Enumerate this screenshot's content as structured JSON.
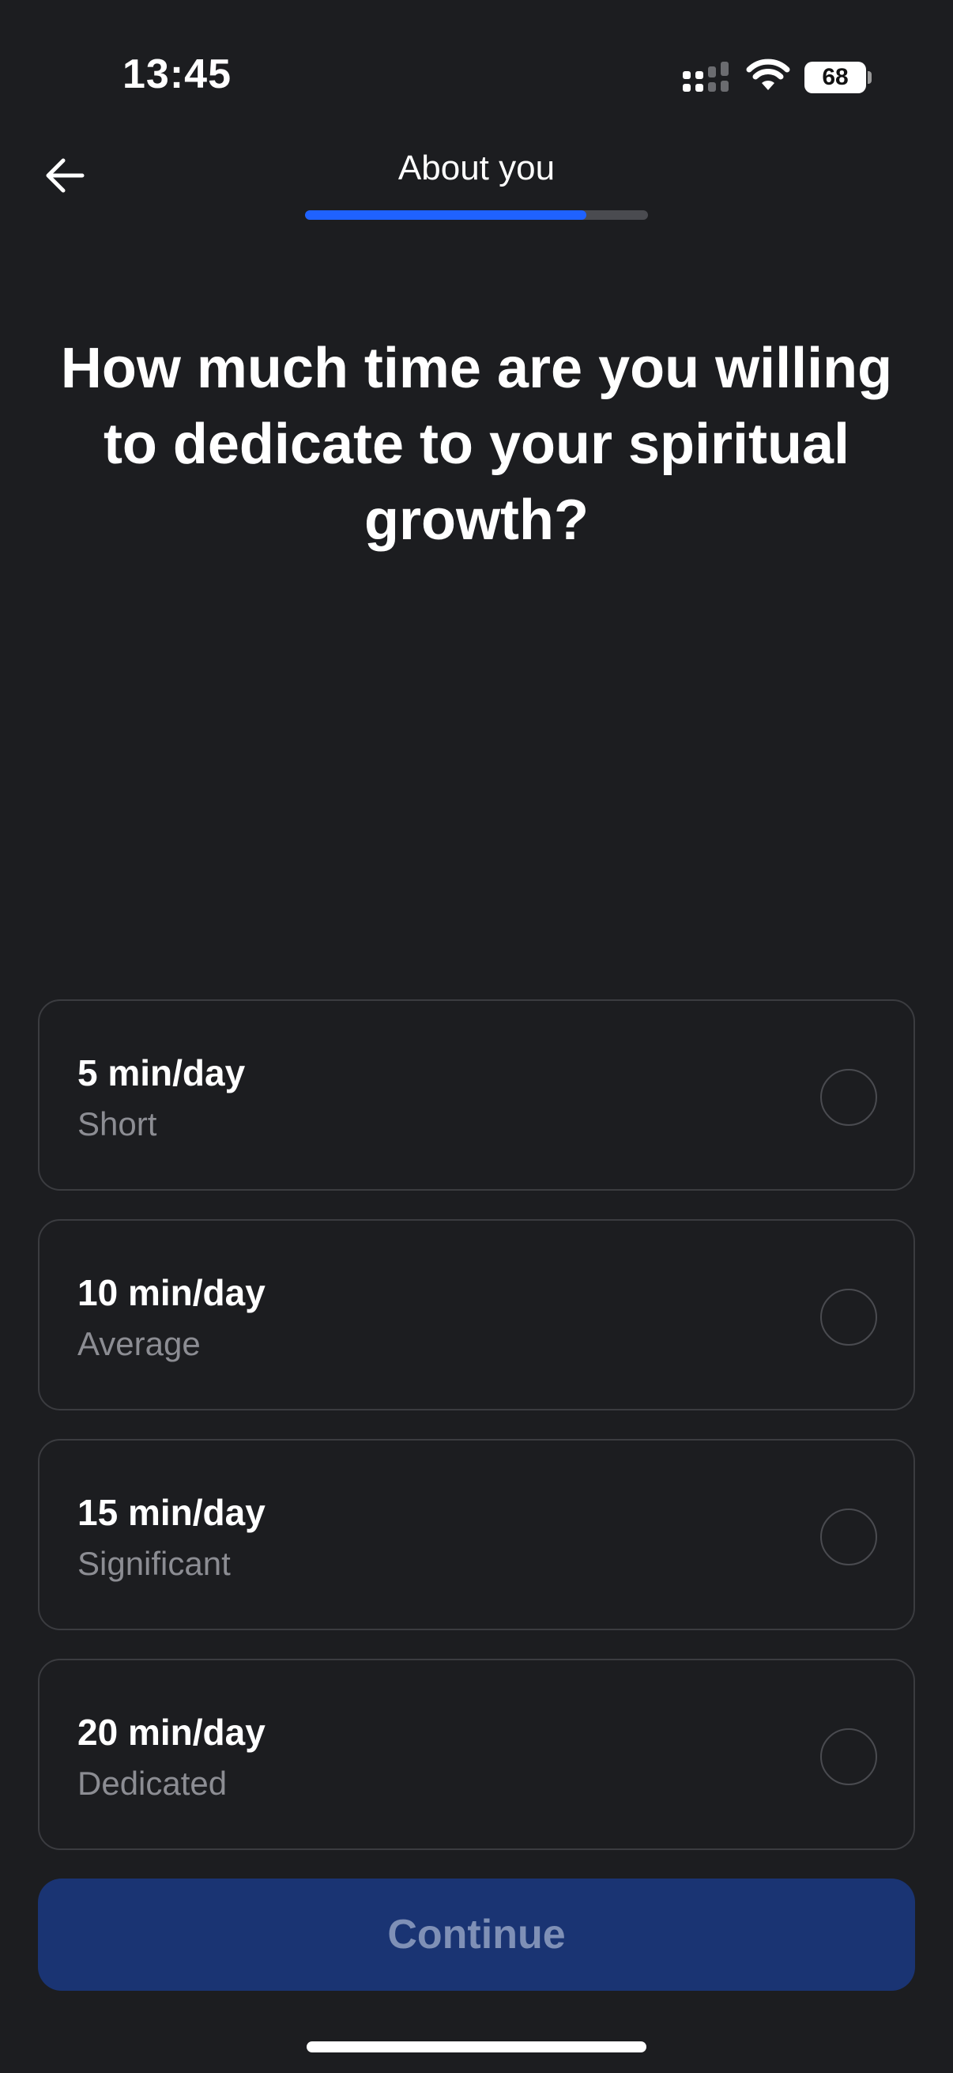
{
  "status_bar": {
    "time": "13:45",
    "battery": "68",
    "icons": [
      "signal-icon",
      "wifi-icon",
      "battery-icon"
    ]
  },
  "header": {
    "back_icon": "arrow-left-icon",
    "title": "About you",
    "progress_fraction": 0.82
  },
  "question": "How much time are you willing to dedicate to your spiritual growth?",
  "options": [
    {
      "title": "5 min/day",
      "subtitle": "Short",
      "selected": false
    },
    {
      "title": "10 min/day",
      "subtitle": "Average",
      "selected": false
    },
    {
      "title": "15 min/day",
      "subtitle": "Significant",
      "selected": false
    },
    {
      "title": "20 min/day",
      "subtitle": "Dedicated",
      "selected": false
    }
  ],
  "continue_label": "Continue",
  "colors": {
    "background": "#1c1d20",
    "accent": "#1f62ff",
    "button_disabled": "#1a3473",
    "button_text_disabled": "#7f90b6",
    "subtitle": "#8c8d93"
  }
}
